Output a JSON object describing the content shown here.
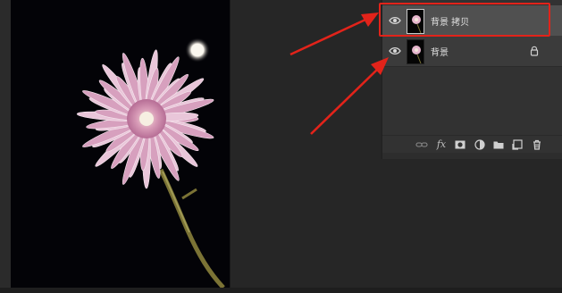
{
  "layers": [
    {
      "name": "背景 拷贝",
      "visible": true,
      "selected": true,
      "locked": false
    },
    {
      "name": "背景",
      "visible": true,
      "selected": false,
      "locked": true
    }
  ],
  "toolbar_icons": [
    "link-icon",
    "fx-icon",
    "mask-icon",
    "adjustment-icon",
    "folder-icon",
    "new-layer-icon",
    "trash-icon"
  ],
  "fx_label": "fx",
  "colors": {
    "annotation": "#e2231a",
    "panel": "#323232",
    "selected_row": "#505050",
    "canvas_bg": "#030307"
  }
}
